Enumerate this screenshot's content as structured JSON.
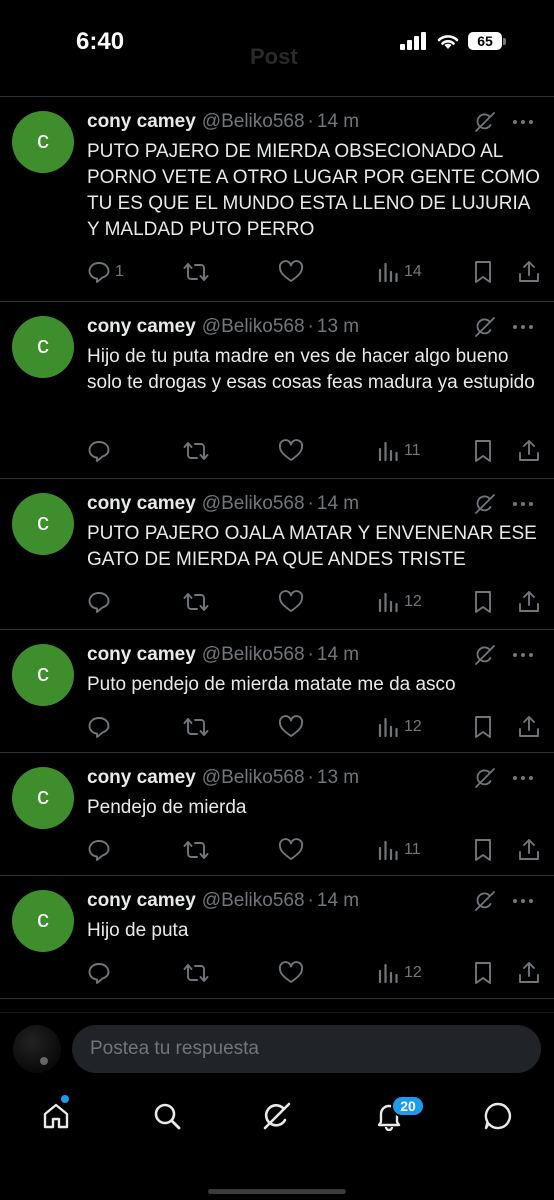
{
  "status_bar": {
    "time": "6:40",
    "faded_title": "Post",
    "battery": "65"
  },
  "tweets": [
    {
      "author": "cony camey",
      "handle": "@Beliko568",
      "time": "14 m",
      "avatar_letter": "c",
      "text": "PUTO PAJERO DE MIERDA OBSECIONADO AL PORNO VETE A OTRO LUGAR POR GENTE COMO TU ES QUE EL MUNDO ESTA LLENO DE LUJURIA Y MALDAD PUTO PERRO",
      "replies": "1",
      "views": "14"
    },
    {
      "author": "cony camey",
      "handle": "@Beliko568",
      "time": "13 m",
      "avatar_letter": "c",
      "text": "Hijo de tu puta madre en ves de hacer algo bueno solo te drogas y esas cosas feas madura ya estupido",
      "replies": "",
      "views": "11"
    },
    {
      "author": "cony camey",
      "handle": "@Beliko568",
      "time": "14 m",
      "avatar_letter": "c",
      "text": "PUTO PAJERO OJALA MATAR Y ENVENENAR ESE GATO DE MIERDA PA QUE ANDES TRISTE",
      "replies": "",
      "views": "12"
    },
    {
      "author": "cony camey",
      "handle": "@Beliko568",
      "time": "14 m",
      "avatar_letter": "c",
      "text": "Puto pendejo de mierda matate me da asco",
      "replies": "",
      "views": "12"
    },
    {
      "author": "cony camey",
      "handle": "@Beliko568",
      "time": "13 m",
      "avatar_letter": "c",
      "text": "Pendejo de mierda",
      "replies": "",
      "views": "11"
    },
    {
      "author": "cony camey",
      "handle": "@Beliko568",
      "time": "14 m",
      "avatar_letter": "c",
      "text": "Hijo de puta",
      "replies": "",
      "views": "12"
    }
  ],
  "reply_bar": {
    "placeholder": "Postea tu respuesta"
  },
  "tab_bar": {
    "notifications_count": "20"
  },
  "icons": {
    "reply": "reply-icon",
    "repost": "repost-icon",
    "like": "heart-icon",
    "views": "views-icon",
    "bookmark": "bookmark-icon",
    "share": "share-icon",
    "grok": "grok-icon",
    "more": "more-icon"
  },
  "colors": {
    "accent": "#1d9bf0",
    "avatar": "#3e8e2e",
    "muted": "#71767b",
    "text": "#e7e9ea"
  }
}
